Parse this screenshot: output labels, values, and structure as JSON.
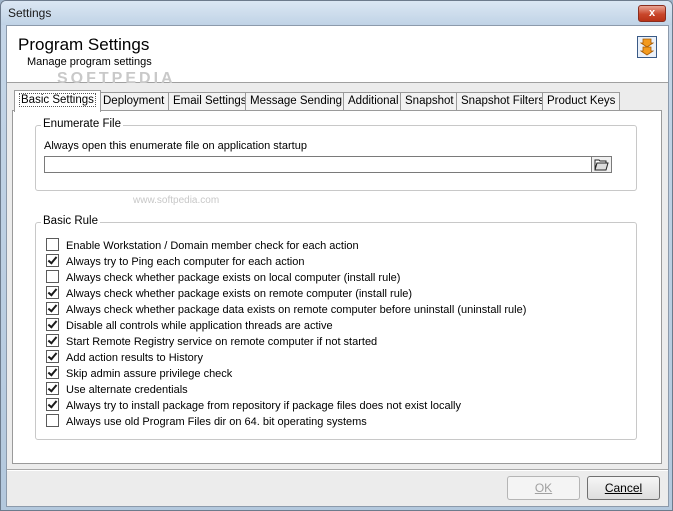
{
  "window": {
    "title": "Settings",
    "close_label": "x"
  },
  "header": {
    "title": "Program Settings",
    "subtitle": "Manage program settings",
    "watermark": "SOFTPEDIA",
    "watermark_small": "www.softpedia.com"
  },
  "tabs": [
    {
      "label": "Basic Settings",
      "active": true
    },
    {
      "label": "Deployment",
      "active": false
    },
    {
      "label": "Email Settings",
      "active": false
    },
    {
      "label": "Message Sending",
      "active": false
    },
    {
      "label": "Additional",
      "active": false
    },
    {
      "label": "Snapshot",
      "active": false
    },
    {
      "label": "Snapshot Filters",
      "active": false
    },
    {
      "label": "Product Keys",
      "active": false
    }
  ],
  "enumerate_group": {
    "label": "Enumerate File",
    "field_label": "Always open this enumerate file on application startup",
    "file_value": "",
    "browse_icon": "folder-open-icon"
  },
  "rule_group": {
    "label": "Basic Rule",
    "items": [
      {
        "label": "Enable Workstation / Domain member check for each action",
        "checked": false
      },
      {
        "label": "Always try to Ping each computer for each action",
        "checked": true
      },
      {
        "label": "Always check whether package exists on local computer (install rule)",
        "checked": false
      },
      {
        "label": "Always check whether package exists on remote computer (install rule)",
        "checked": true
      },
      {
        "label": "Always check whether package data exists on remote computer before uninstall (uninstall rule)",
        "checked": true
      },
      {
        "label": "Disable all controls while application threads are active",
        "checked": true
      },
      {
        "label": "Start Remote Registry service on remote computer if not started",
        "checked": true
      },
      {
        "label": "Add action results to History",
        "checked": true
      },
      {
        "label": "Skip admin assure privilege check",
        "checked": true
      },
      {
        "label": "Use alternate credentials",
        "checked": true
      },
      {
        "label": "Always try to install package from repository if package files does not exist locally",
        "checked": true
      },
      {
        "label": "Always use old Program Files dir on 64. bit operating systems",
        "checked": false
      }
    ]
  },
  "buttons": {
    "ok_label": "OK",
    "ok_enabled": false,
    "cancel_label": "Cancel",
    "cancel_enabled": true
  }
}
